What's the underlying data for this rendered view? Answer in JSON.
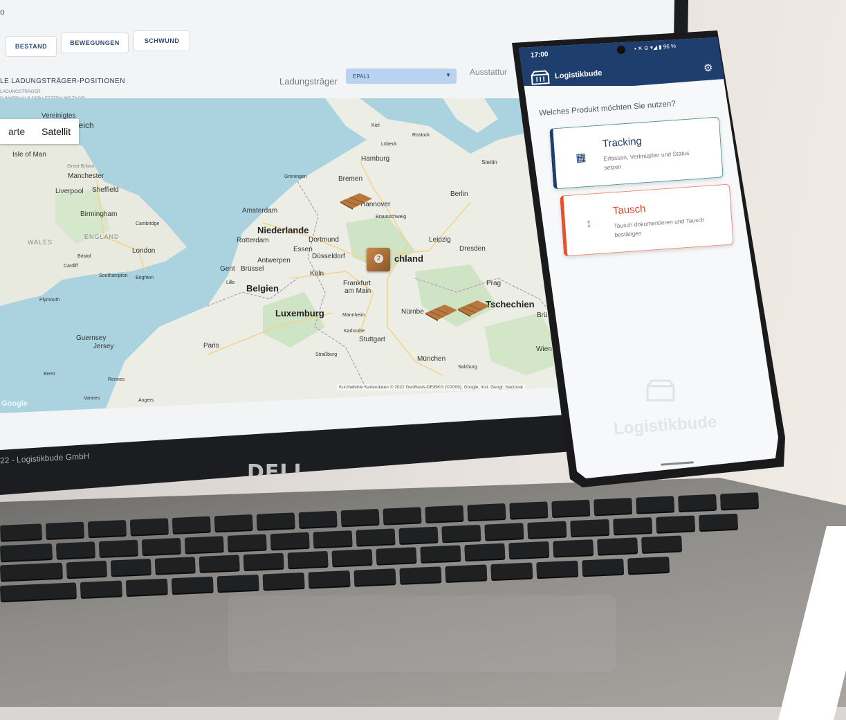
{
  "laptop": {
    "header_fragment": "o",
    "tabs": [
      "BESTAND",
      "BEWEGUNGEN",
      "SCHWUND"
    ],
    "panel": {
      "title": "LE LADUNGSTRÄGER-POSITIONEN",
      "sub1": "LADUNGSTRÄGER",
      "sub2": "D INNERHALB DER LETZTEN 365 TAGE)"
    },
    "ladungstraeger_label": "Ladungsträger",
    "ladungstraeger_value": "EPAL1",
    "ausstattung_label": "Ausstattur",
    "map": {
      "toggle": [
        "arte",
        "Satellit"
      ],
      "cities": [
        {
          "name": "Vereinigtes"
        },
        {
          "name": "greich"
        },
        {
          "name": "Isle of Man"
        },
        {
          "name": "Great Britain"
        },
        {
          "name": "Manchester"
        },
        {
          "name": "Liverpool"
        },
        {
          "name": "Sheffield"
        },
        {
          "name": "Birmingham"
        },
        {
          "name": "Cambridge"
        },
        {
          "name": "WALES"
        },
        {
          "name": "ENGLAND"
        },
        {
          "name": "London"
        },
        {
          "name": "Bristol"
        },
        {
          "name": "Cardiff"
        },
        {
          "name": "Southampton"
        },
        {
          "name": "Brighton"
        },
        {
          "name": "Plymouth"
        },
        {
          "name": "Guernsey"
        },
        {
          "name": "Jersey"
        },
        {
          "name": "Brest"
        },
        {
          "name": "Rennes"
        },
        {
          "name": "Vannes"
        },
        {
          "name": "Angers"
        },
        {
          "name": "Paris"
        },
        {
          "name": "Amsterdam"
        },
        {
          "name": "Rotterdam"
        },
        {
          "name": "Antwerpen"
        },
        {
          "name": "Gent"
        },
        {
          "name": "Brüssel"
        },
        {
          "name": "Lille"
        },
        {
          "name": "Essen"
        },
        {
          "name": "Dortmund"
        },
        {
          "name": "Düsseldorf"
        },
        {
          "name": "Köln"
        },
        {
          "name": "Frankfurt"
        },
        {
          "name": "am Main"
        },
        {
          "name": "Mannheim"
        },
        {
          "name": "Karlsruhe"
        },
        {
          "name": "Stuttgart"
        },
        {
          "name": "Straßburg"
        },
        {
          "name": "München"
        },
        {
          "name": "Salzburg"
        },
        {
          "name": "Nürnbe"
        },
        {
          "name": "Prag"
        },
        {
          "name": "Brü"
        },
        {
          "name": "Wien"
        },
        {
          "name": "Dresden"
        },
        {
          "name": "Leipzig"
        },
        {
          "name": "Berlin"
        },
        {
          "name": "Stettin"
        },
        {
          "name": "Rostock"
        },
        {
          "name": "Lübeck"
        },
        {
          "name": "Kiel"
        },
        {
          "name": "Hamburg"
        },
        {
          "name": "Bremen"
        },
        {
          "name": "Hannover"
        },
        {
          "name": "Braunschweig"
        },
        {
          "name": "Groningen"
        }
      ],
      "countries": [
        "Niederlande",
        "Belgien",
        "Luxemburg",
        "chland",
        "Tschechien"
      ],
      "cluster_count": "2",
      "attribution": "Kurzbefehle   Kartendaten © 2022 GeoBasis-DE/BKG (©2009), Google, Inst. Geogr. Nacional",
      "watermark": "Google"
    },
    "footer": "22 - Logistikbude GmbH",
    "brand": "DELL"
  },
  "phone": {
    "time": "17:00",
    "status_icons": "• ✕ ⊝ ▾◢ ▮ 96 %",
    "app_title": "Logistikbude",
    "question": "Welches Produkt möchten Sie nutzen?",
    "cards": [
      {
        "title": "Tracking",
        "desc": "Erfassen, Verknüpfen und Status setzen",
        "icon": "qr-code-icon"
      },
      {
        "title": "Tausch",
        "desc": "Tausch dokumentieren und Tausch bestätigen",
        "icon": "exchange-icon"
      }
    ],
    "watermark": "Logistikbude",
    "colors": {
      "primary": "#1e3f6e",
      "tausch": "#e8502a",
      "tracking_border": "#4a9a8c"
    }
  }
}
